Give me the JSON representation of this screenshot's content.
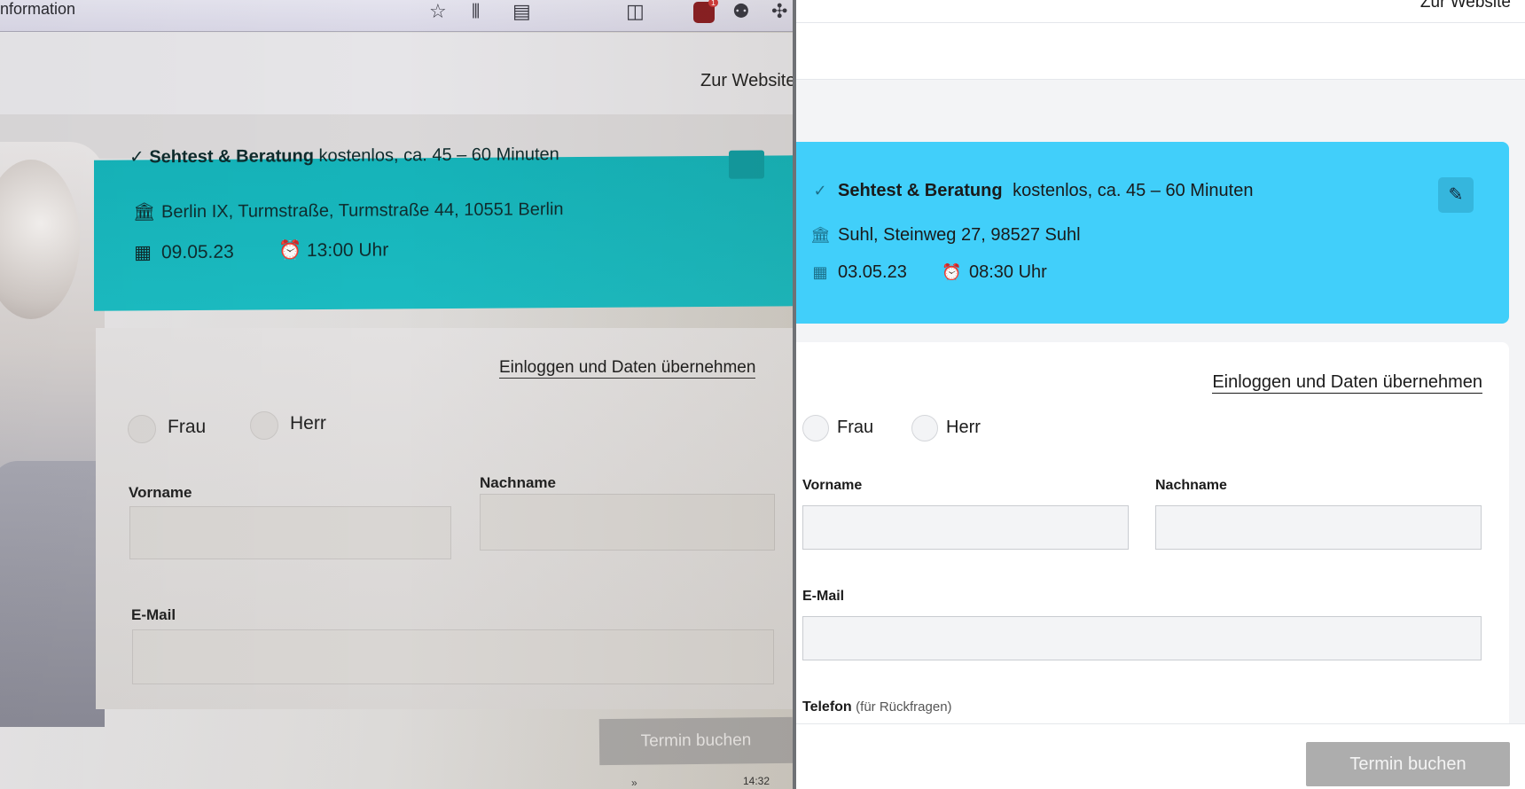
{
  "photo": {
    "browser": {
      "title_fragment": "nformation",
      "toolbar_icons": [
        "star-icon",
        "library-icon",
        "reader-icon",
        "pocket-icon",
        "extension-badge-icon",
        "extension-icon",
        "puzzle-icon"
      ],
      "badge_count": "1"
    },
    "site": {
      "zur_website": "Zur Website"
    },
    "appointment": {
      "service_title": "Sehtest & Beratung",
      "service_details": "kostenlos,  ca. 45 – 60 Minuten",
      "location": "Berlin IX, Turmstraße, Turmstraße 44, 10551 Berlin",
      "date": "09.05.23",
      "time": "13:00 Uhr"
    },
    "form": {
      "login_link": "Einloggen und Daten übernehmen",
      "salutation_frau": "Frau",
      "salutation_herr": "Herr",
      "vorname_label": "Vorname",
      "nachname_label": "Nachname",
      "email_label": "E-Mail",
      "submit_label": "Termin buchen"
    },
    "taskbar_clock": "14:32",
    "taskbar_arrow": "»"
  },
  "screen": {
    "zur_website": "Zur Website",
    "appointment": {
      "check": "✓",
      "service_title": "Sehtest & Beratung",
      "service_details": "kostenlos,  ca. 45 – 60 Minuten",
      "location": "Suhl, Steinweg 27, 98527 Suhl",
      "date": "03.05.23",
      "time": "08:30 Uhr",
      "accent_color": "#41cffa"
    },
    "form": {
      "login_link": "Einloggen und Daten übernehmen",
      "salutation_frau": "Frau",
      "salutation_herr": "Herr",
      "vorname_label": "Vorname",
      "nachname_label": "Nachname",
      "email_label": "E-Mail",
      "telefon_label": "Telefon",
      "telefon_hint": "(für Rückfragen)",
      "vorname_value": "",
      "nachname_value": "",
      "email_value": ""
    },
    "footer": {
      "submit_label": "Termin buchen"
    }
  }
}
